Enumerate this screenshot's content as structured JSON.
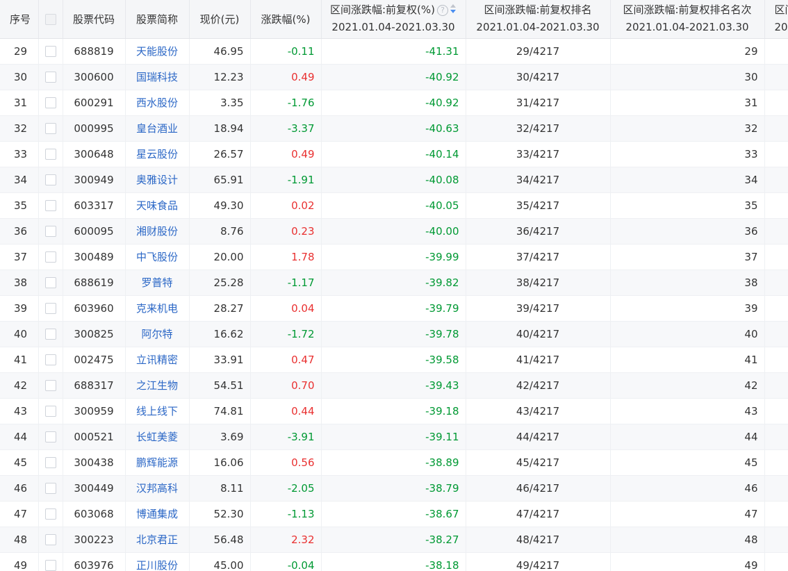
{
  "header": {
    "seq": "序号",
    "code": "股票代码",
    "name": "股票简称",
    "price": "现价(元)",
    "change": "涨跌幅(%)",
    "range_change": "区间涨跌幅:前复权(%)",
    "range_rank": "区间涨跌幅:前复权排名",
    "range_rank_no": "区间涨跌幅:前复权排名名次",
    "more": "区间",
    "date_range": "2021.01.04-2021.03.30",
    "help_icon_glyph": "?"
  },
  "colors": {
    "up": "#e93030",
    "down": "#009933",
    "link": "#2b67c6",
    "header_bg": "#f5f6f8",
    "stripe_bg": "#f7f8fa"
  },
  "rows": [
    {
      "seq": "29",
      "code": "688819",
      "name": "天能股份",
      "price": "46.95",
      "change": "-0.11",
      "dir": "down",
      "range_change": "-41.31",
      "rank": "29/4217",
      "rank_no": "29"
    },
    {
      "seq": "30",
      "code": "300600",
      "name": "国瑞科技",
      "price": "12.23",
      "change": "0.49",
      "dir": "up",
      "range_change": "-40.92",
      "rank": "30/4217",
      "rank_no": "30"
    },
    {
      "seq": "31",
      "code": "600291",
      "name": "西水股份",
      "price": "3.35",
      "change": "-1.76",
      "dir": "down",
      "range_change": "-40.92",
      "rank": "31/4217",
      "rank_no": "31"
    },
    {
      "seq": "32",
      "code": "000995",
      "name": "皇台酒业",
      "price": "18.94",
      "change": "-3.37",
      "dir": "down",
      "range_change": "-40.63",
      "rank": "32/4217",
      "rank_no": "32"
    },
    {
      "seq": "33",
      "code": "300648",
      "name": "星云股份",
      "price": "26.57",
      "change": "0.49",
      "dir": "up",
      "range_change": "-40.14",
      "rank": "33/4217",
      "rank_no": "33"
    },
    {
      "seq": "34",
      "code": "300949",
      "name": "奥雅设计",
      "price": "65.91",
      "change": "-1.91",
      "dir": "down",
      "range_change": "-40.08",
      "rank": "34/4217",
      "rank_no": "34"
    },
    {
      "seq": "35",
      "code": "603317",
      "name": "天味食品",
      "price": "49.30",
      "change": "0.02",
      "dir": "up",
      "range_change": "-40.05",
      "rank": "35/4217",
      "rank_no": "35"
    },
    {
      "seq": "36",
      "code": "600095",
      "name": "湘财股份",
      "price": "8.76",
      "change": "0.23",
      "dir": "up",
      "range_change": "-40.00",
      "rank": "36/4217",
      "rank_no": "36"
    },
    {
      "seq": "37",
      "code": "300489",
      "name": "中飞股份",
      "price": "20.00",
      "change": "1.78",
      "dir": "up",
      "range_change": "-39.99",
      "rank": "37/4217",
      "rank_no": "37"
    },
    {
      "seq": "38",
      "code": "688619",
      "name": "罗普特",
      "price": "25.28",
      "change": "-1.17",
      "dir": "down",
      "range_change": "-39.82",
      "rank": "38/4217",
      "rank_no": "38"
    },
    {
      "seq": "39",
      "code": "603960",
      "name": "克来机电",
      "price": "28.27",
      "change": "0.04",
      "dir": "up",
      "range_change": "-39.79",
      "rank": "39/4217",
      "rank_no": "39"
    },
    {
      "seq": "40",
      "code": "300825",
      "name": "阿尔特",
      "price": "16.62",
      "change": "-1.72",
      "dir": "down",
      "range_change": "-39.78",
      "rank": "40/4217",
      "rank_no": "40"
    },
    {
      "seq": "41",
      "code": "002475",
      "name": "立讯精密",
      "price": "33.91",
      "change": "0.47",
      "dir": "up",
      "range_change": "-39.58",
      "rank": "41/4217",
      "rank_no": "41"
    },
    {
      "seq": "42",
      "code": "688317",
      "name": "之江生物",
      "price": "54.51",
      "change": "0.70",
      "dir": "up",
      "range_change": "-39.43",
      "rank": "42/4217",
      "rank_no": "42"
    },
    {
      "seq": "43",
      "code": "300959",
      "name": "线上线下",
      "price": "74.81",
      "change": "0.44",
      "dir": "up",
      "range_change": "-39.18",
      "rank": "43/4217",
      "rank_no": "43"
    },
    {
      "seq": "44",
      "code": "000521",
      "name": "长虹美菱",
      "price": "3.69",
      "change": "-3.91",
      "dir": "down",
      "range_change": "-39.11",
      "rank": "44/4217",
      "rank_no": "44"
    },
    {
      "seq": "45",
      "code": "300438",
      "name": "鹏辉能源",
      "price": "16.06",
      "change": "0.56",
      "dir": "up",
      "range_change": "-38.89",
      "rank": "45/4217",
      "rank_no": "45"
    },
    {
      "seq": "46",
      "code": "300449",
      "name": "汉邦高科",
      "price": "8.11",
      "change": "-2.05",
      "dir": "down",
      "range_change": "-38.79",
      "rank": "46/4217",
      "rank_no": "46"
    },
    {
      "seq": "47",
      "code": "603068",
      "name": "博通集成",
      "price": "52.30",
      "change": "-1.13",
      "dir": "down",
      "range_change": "-38.67",
      "rank": "47/4217",
      "rank_no": "47"
    },
    {
      "seq": "48",
      "code": "300223",
      "name": "北京君正",
      "price": "56.48",
      "change": "2.32",
      "dir": "up",
      "range_change": "-38.27",
      "rank": "48/4217",
      "rank_no": "48"
    },
    {
      "seq": "49",
      "code": "603976",
      "name": "正川股份",
      "price": "45.00",
      "change": "-0.04",
      "dir": "down",
      "range_change": "-38.18",
      "rank": "49/4217",
      "rank_no": "49"
    }
  ]
}
